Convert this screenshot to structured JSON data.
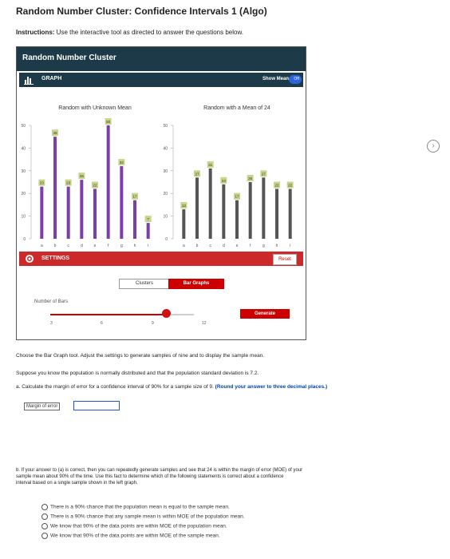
{
  "page": {
    "title": "Random Number Cluster: Confidence Intervals 1 (Algo)",
    "instructions_label": "Instructions:",
    "instructions_text": " Use the interactive tool as directed to answer the questions below."
  },
  "widget": {
    "title": "Random Number Cluster",
    "graph_label": "GRAPH",
    "show_mean_label": "Show Mean",
    "toggle_state": "Off",
    "settings_label": "SETTINGS",
    "reset_label": "Reset",
    "mode_clusters": "Clusters",
    "mode_bar_graphs": "Bar Graphs",
    "number_of_bars_label": "Number of Bars",
    "slider_ticks": [
      "3",
      "6",
      "9",
      "12"
    ],
    "generate_label": "Generate",
    "colors": {
      "header": "#1c3a47",
      "accent": "#cc2a2a",
      "bar_left": "#7b3fa8",
      "bar_right": "#555555"
    }
  },
  "chart_data": [
    {
      "type": "bar",
      "title": "Random with Unknown Mean",
      "categories": [
        "a",
        "b",
        "c",
        "d",
        "e",
        "f",
        "g",
        "h",
        "i"
      ],
      "values": [
        23,
        45,
        23,
        26,
        22,
        50,
        32,
        17,
        7
      ],
      "ylim": [
        0,
        50
      ],
      "yticks": [
        "0",
        "10",
        "20",
        "30",
        "40",
        "50"
      ]
    },
    {
      "type": "bar",
      "title": "Random with a Mean of 24",
      "categories": [
        "a",
        "b",
        "c",
        "d",
        "e",
        "f",
        "g",
        "h",
        "i"
      ],
      "values": [
        13,
        27,
        31,
        24,
        17,
        25,
        27,
        22,
        22
      ],
      "ylim": [
        0,
        50
      ],
      "yticks": [
        "0",
        "10",
        "20",
        "30",
        "40",
        "50"
      ]
    }
  ],
  "questions": {
    "intro": "Choose the Bar Graph tool. Adjust the settings to generate samples of nine and to display the sample mean.",
    "suppose": "Suppose you know the population is normally distributed and that the population standard deviation is 7.2.",
    "part_a": "a. Calculate the margin of error for a confidence interval of 90% for a sample size of 9.",
    "part_a_hint": "(Round your answer to three decimal places.)",
    "moe_label": "Margin of error",
    "part_b_line1": "b. If your answer to (a) is correct, then you can repeatedly generate samples and see that 24 is within the margin of error (MOE) of your",
    "part_b_line2": "sample mean about 90% of the time. Use this fact to determine which of the following statements is correct about a confidence",
    "part_b_line3": "interval based on a single sample shown in the left graph.",
    "options": [
      "There is a 90% chance that the population mean is equal to the sample mean.",
      "There is a 90% chance that any sample mean is within MOE of the population mean.",
      "We know that 90% of the data points are within MOE of the population mean.",
      "We know that 90% of the data points are within MOE of the sample mean."
    ]
  }
}
